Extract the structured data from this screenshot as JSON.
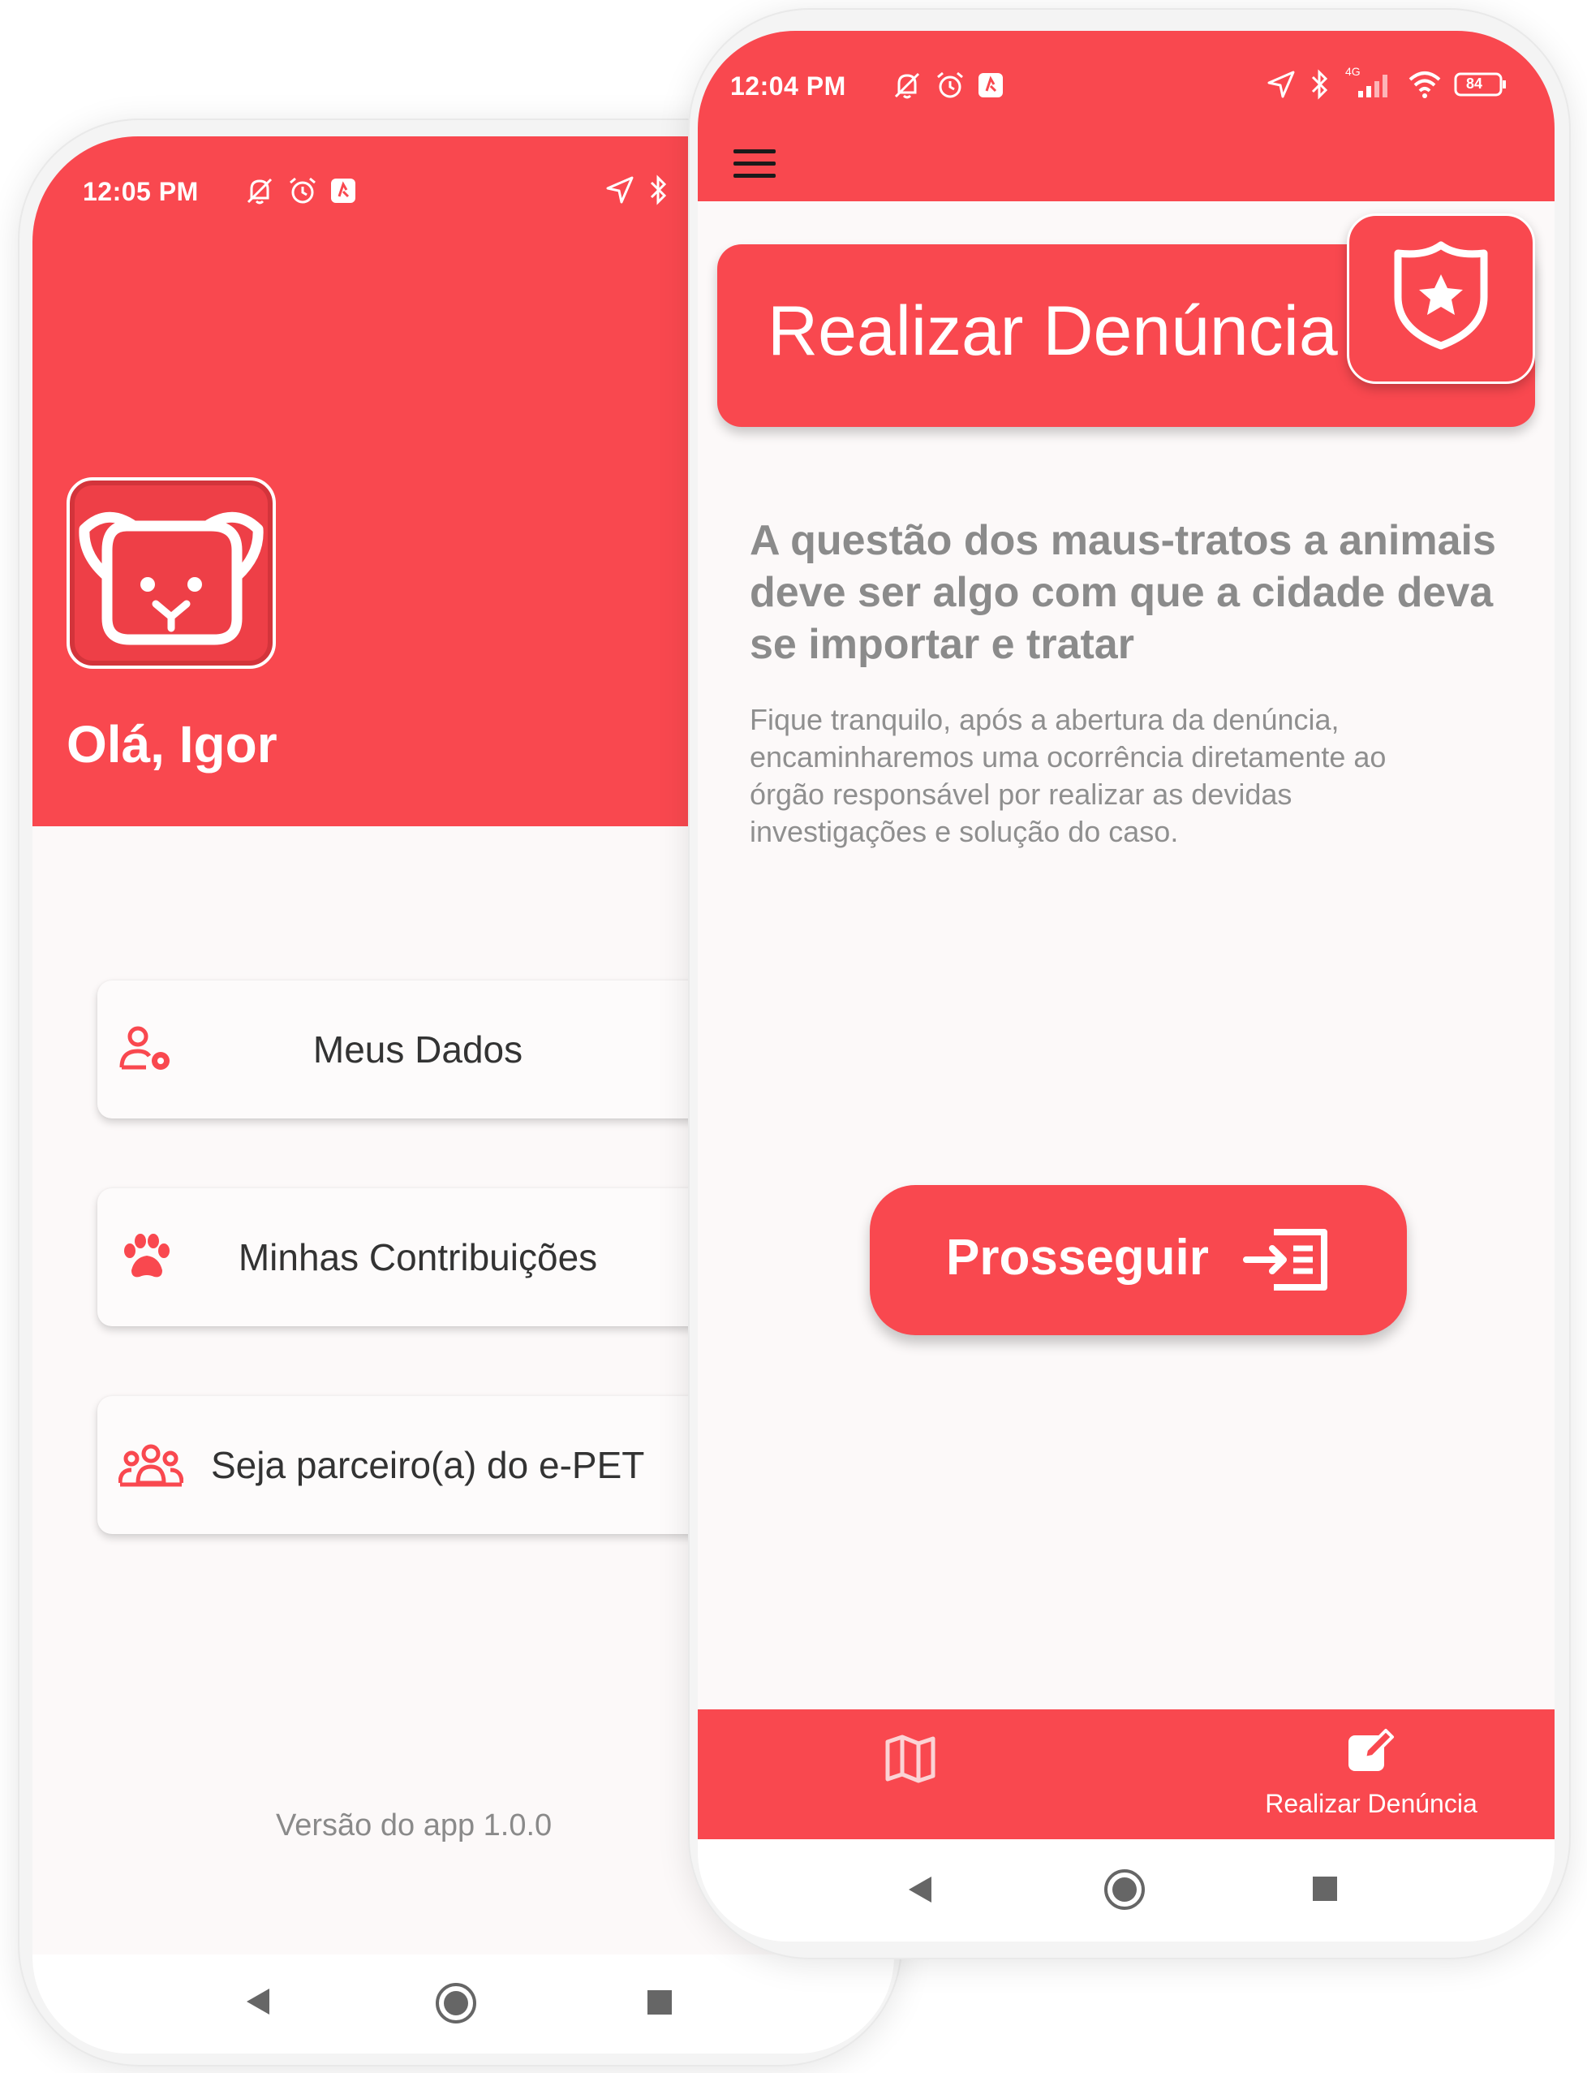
{
  "left_screen": {
    "status_bar": {
      "time": "12:05 PM"
    },
    "greeting": "Olá, Igor",
    "menu_items": [
      {
        "label": "Meus Dados",
        "icon": "user-gear-icon"
      },
      {
        "label": "Minhas Contribuições",
        "icon": "paw-icon"
      },
      {
        "label": "Seja parceiro(a) do e-PET",
        "icon": "users-group-icon"
      }
    ],
    "version": "Versão do app 1.0.0",
    "colors": {
      "primary": "#f9484f",
      "background": "#fcf9f9"
    }
  },
  "right_screen": {
    "status_bar": {
      "time": "12:04 PM",
      "network": "4G",
      "battery": "84"
    },
    "title": "Realizar Denúncia",
    "heading": "A questão dos maus-tratos a animais deve ser algo com que a cidade deva se importar e tratar",
    "description": "Fique tranquilo, após a abertura da denúncia, encaminharemos uma ocorrência diretamente ao órgão responsável por realizar as devidas investigações e solução do caso.",
    "proceed_button": "Prosseguir",
    "bottom_nav": [
      {
        "icon": "map-icon",
        "label": ""
      },
      {
        "icon": "edit-icon",
        "label": "Realizar Denúncia"
      }
    ]
  }
}
